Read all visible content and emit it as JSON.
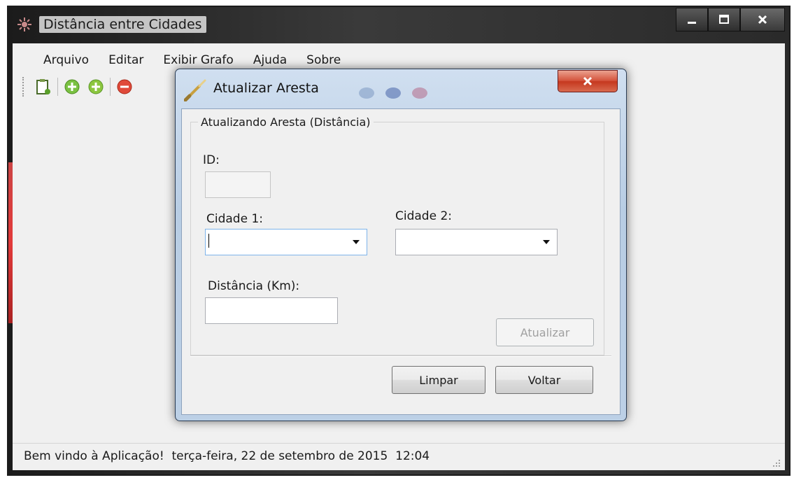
{
  "main_window": {
    "title": "Distância entre Cidades",
    "menu": [
      "Arquivo",
      "Editar",
      "Exibir Grafo",
      "Ajuda",
      "Sobre"
    ],
    "toolbar_icons": [
      "new-document-icon",
      "add-green-icon",
      "add-green-alt-icon",
      "remove-red-icon"
    ],
    "status_text": "Bem vindo à Aplicação!  terça-feira, 22 de setembro de 2015  12:04"
  },
  "dialog": {
    "title": "Atualizar Aresta",
    "group_title": "Atualizando Aresta (Distância)",
    "id_label": "ID:",
    "id_value": "",
    "cidade1_label": "Cidade 1:",
    "cidade1_value": "",
    "cidade2_label": "Cidade 2:",
    "cidade2_value": "",
    "distancia_label": "Distância (Km):",
    "distancia_value": "",
    "atualizar_label": "Atualizar",
    "limpar_label": "Limpar",
    "voltar_label": "Voltar"
  },
  "colors": {
    "dialog_frame": "#bcd0e6",
    "close_red": "#c5381f",
    "title_bar_dark": "#2a2a2a"
  }
}
